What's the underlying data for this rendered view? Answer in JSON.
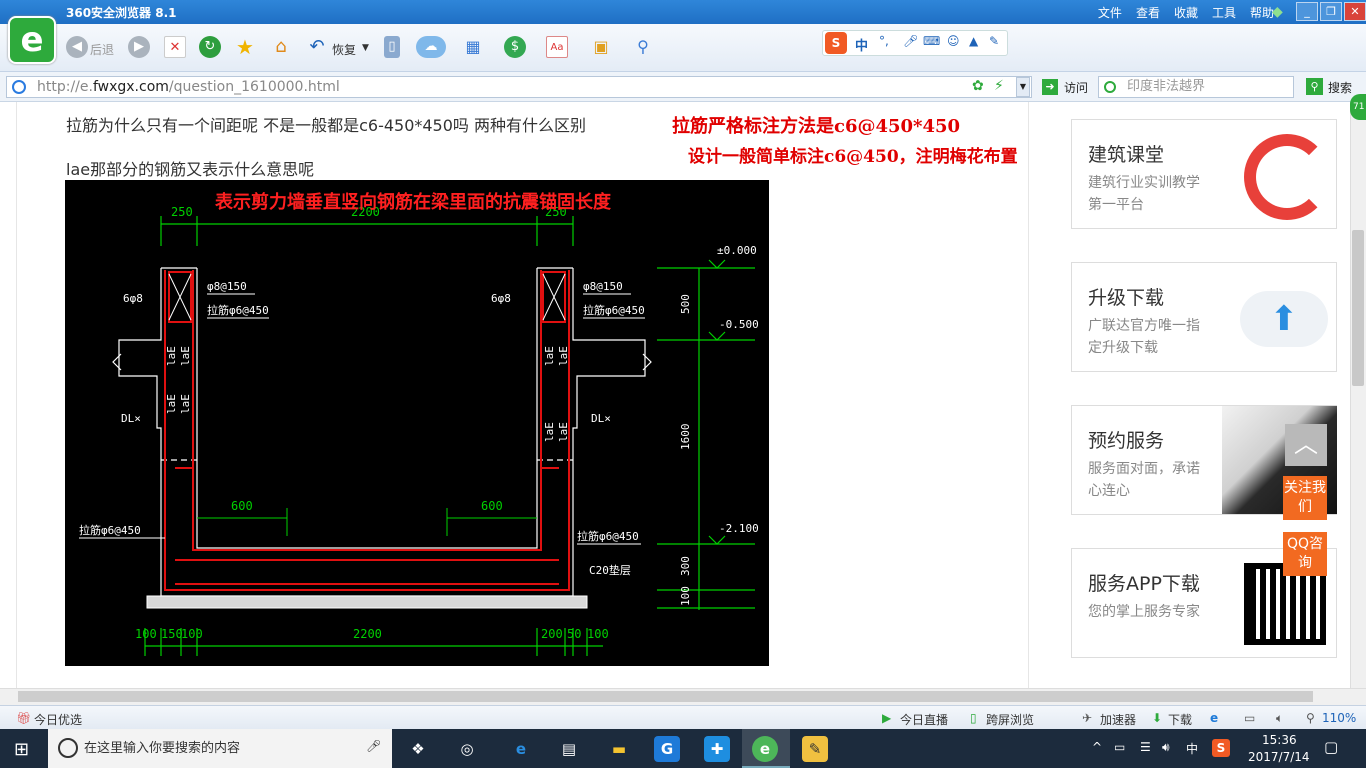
{
  "window": {
    "title": "360安全浏览器 8.1",
    "menu": [
      "文件",
      "查看",
      "收藏",
      "工具",
      "帮助"
    ]
  },
  "toolbar": {
    "back_label": "后退",
    "restore_label": "恢复",
    "sogou_label": "中",
    "logo_glyph": "e"
  },
  "address": {
    "url_prefix": "http://e.",
    "url_domain": "fwxgx.com",
    "url_path": "/question_1610000.html",
    "visit_label": "访问",
    "search_placeholder": "印度非法越界",
    "search_button": "搜索"
  },
  "content": {
    "question_line1": "拉筋为什么只有一个间距呢 不是一般都是c6-450*450吗 两种有什么区别",
    "question_line2": "lae那部分的钢筋又表示什么意思呢",
    "red_note1": "拉筋严格标注方法是c6@450*450",
    "red_note2": "设计一般简单标注c6@450，注明梅花布置",
    "drawing_caption": "表示剪力墙垂直竖向钢筋在梁里面的抗震锚固长度"
  },
  "drawing": {
    "dim_top": [
      "250",
      "2200",
      "250"
    ],
    "dim_bottom": [
      "100",
      "150",
      "100",
      "2200",
      "200",
      "50",
      "100"
    ],
    "dim_inner_left": "600",
    "dim_inner_right": "600",
    "elev_labels": [
      "±0.000",
      "-0.500",
      "-2.100"
    ],
    "dim_right": [
      "500",
      "1600",
      "300",
      "100"
    ],
    "rebar_labels": [
      "φ8@150",
      "拉筋φ6@450",
      "6φ8",
      "φ8@150",
      "拉筋φ6@450",
      "6φ8"
    ],
    "lae_label": "laE",
    "dl_label": "DL×",
    "tie_left": "拉筋φ6@450",
    "tie_right": "拉筋φ6@450",
    "c20_label": "C20垫层"
  },
  "sidebar": {
    "cards": [
      {
        "title": "建筑课堂",
        "desc": "建筑行业实训教学第一平台"
      },
      {
        "title": "升级下载",
        "desc": "广联达官方唯一指定升级下载"
      },
      {
        "title": "预约服务",
        "desc": "服务面对面，承诺心连心"
      },
      {
        "title": "服务APP下载",
        "desc": "您的掌上服务专家"
      }
    ],
    "follow_label": "关注我们",
    "qq_label": "QQ咨询"
  },
  "statusbar": {
    "left": "今日优选",
    "live": "今日直播",
    "cross_screen": "跨屏浏览",
    "accelerator": "加速器",
    "download": "下载",
    "zoom": "110%"
  },
  "taskbar": {
    "search_placeholder": "在这里输入你要搜索的内容",
    "ime": "中",
    "time": "15:36",
    "date": "2017/7/14"
  },
  "colors": {
    "accent_red": "#e00000",
    "cad_green": "#00d000",
    "cad_red": "#e01010",
    "follow_orange": "#f26a21"
  }
}
